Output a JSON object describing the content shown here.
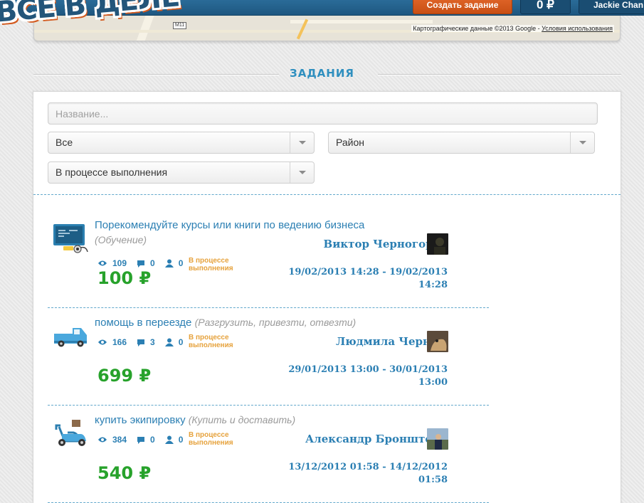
{
  "header": {
    "logo_text": "ВСЕ В ДЕЛЕ",
    "create_button": "Создать задание",
    "balance": "0 ₽",
    "user_name": "Jackie Chan"
  },
  "map": {
    "highway_label": "M11",
    "attribution": "Картографические данные ©2013 Google - ",
    "terms_link": "Условия использования"
  },
  "section_title": "ЗАДАНИЯ",
  "filters": {
    "name_placeholder": "Название...",
    "category_value": "Все",
    "district_value": "Район",
    "status_value": "В процессе выполнения"
  },
  "tasks": [
    {
      "title": "Порекомендуйте курсы или книги по ведению бизнеса",
      "category": "(Обучение)",
      "views": "109",
      "comments": "0",
      "responses": "0",
      "status": "В процессе выполнения",
      "author": "Виктор Черногоров",
      "price": "100 ₽",
      "dates": "19/02/2013 14:28 - 19/02/2013 14:28",
      "icon": "blackboard-icon"
    },
    {
      "title": "помощь в переезде",
      "category": "(Разгрузить, привезти, отвезти)",
      "views": "166",
      "comments": "3",
      "responses": "0",
      "status": "В процессе выполнения",
      "author": "Людмила Черных",
      "price": "699 ₽",
      "dates": "29/01/2013 13:00 - 30/01/2013 13:00",
      "icon": "van-icon"
    },
    {
      "title": "купить экипировку",
      "category": "(Купить и доставить)",
      "views": "384",
      "comments": "0",
      "responses": "0",
      "status": "В процессе выполнения",
      "author": "Александр Бронштейн",
      "price": "540 ₽",
      "dates": "13/12/2012 01:58 - 14/12/2012 01:58",
      "icon": "scooter-icon"
    }
  ],
  "colors": {
    "accent_blue": "#2b7fb3",
    "price_green": "#27a22b",
    "status_orange": "#e6a23c",
    "create_orange": "#d65a1c",
    "header_blue": "#1e5780"
  }
}
